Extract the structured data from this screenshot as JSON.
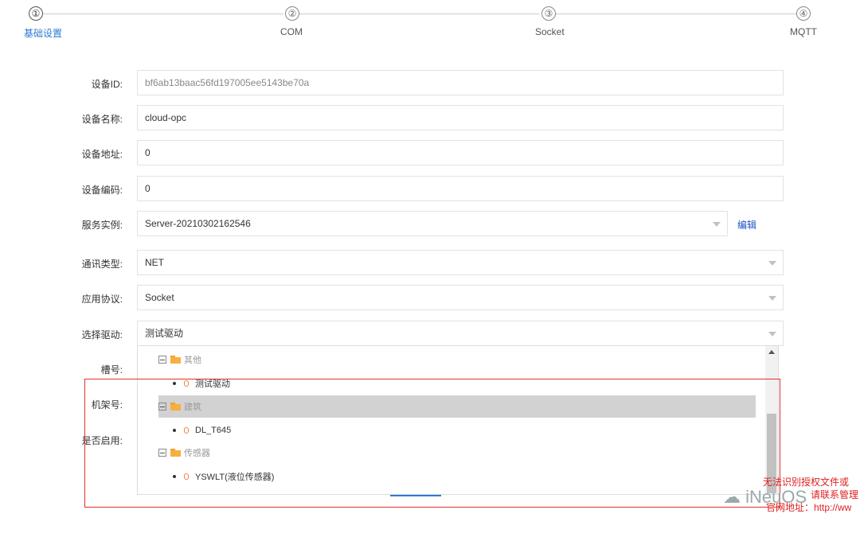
{
  "steps": [
    {
      "number": "①",
      "label": "基础设置",
      "active": true
    },
    {
      "number": "②",
      "label": "COM",
      "active": false
    },
    {
      "number": "③",
      "label": "Socket",
      "active": false
    },
    {
      "number": "④",
      "label": "MQTT",
      "active": false
    }
  ],
  "form": {
    "device_id": {
      "label": "设备ID:",
      "value": "bf6ab13baac56fd197005ee5143be70a"
    },
    "device_name": {
      "label": "设备名称:",
      "value": "cloud-opc"
    },
    "device_address": {
      "label": "设备地址:",
      "value": "0"
    },
    "device_code": {
      "label": "设备编码:",
      "value": "0"
    },
    "service_instance": {
      "label": "服务实例:",
      "value": "Server-20210302162546",
      "edit_label": "编辑"
    },
    "comm_type": {
      "label": "通讯类型:",
      "value": "NET"
    },
    "app_protocol": {
      "label": "应用协议:",
      "value": "Socket"
    },
    "select_driver": {
      "label": "选择驱动:",
      "value": "测试驱动"
    },
    "slot_label": "槽号:",
    "rack_label": "机架号:",
    "enabled_label": "是否启用:"
  },
  "driver_tree": {
    "groups": [
      {
        "label": "其他",
        "items": [
          "测试驱动"
        ]
      },
      {
        "label": "建筑",
        "items": [
          "DL_T645"
        ],
        "highlighted": true
      },
      {
        "label": "传感器",
        "items": [
          "YSWLT(液位传感器)"
        ]
      }
    ]
  },
  "watermark": {
    "logo": "iNeuOS",
    "lines": [
      "无法识别授权文件或",
      "请联系管理",
      "官网地址：http://ww"
    ]
  },
  "colors": {
    "accent": "#2a7bd4",
    "link": "#1e50c8",
    "highlight_box": "#e0302e",
    "folder": "#f5b040"
  }
}
